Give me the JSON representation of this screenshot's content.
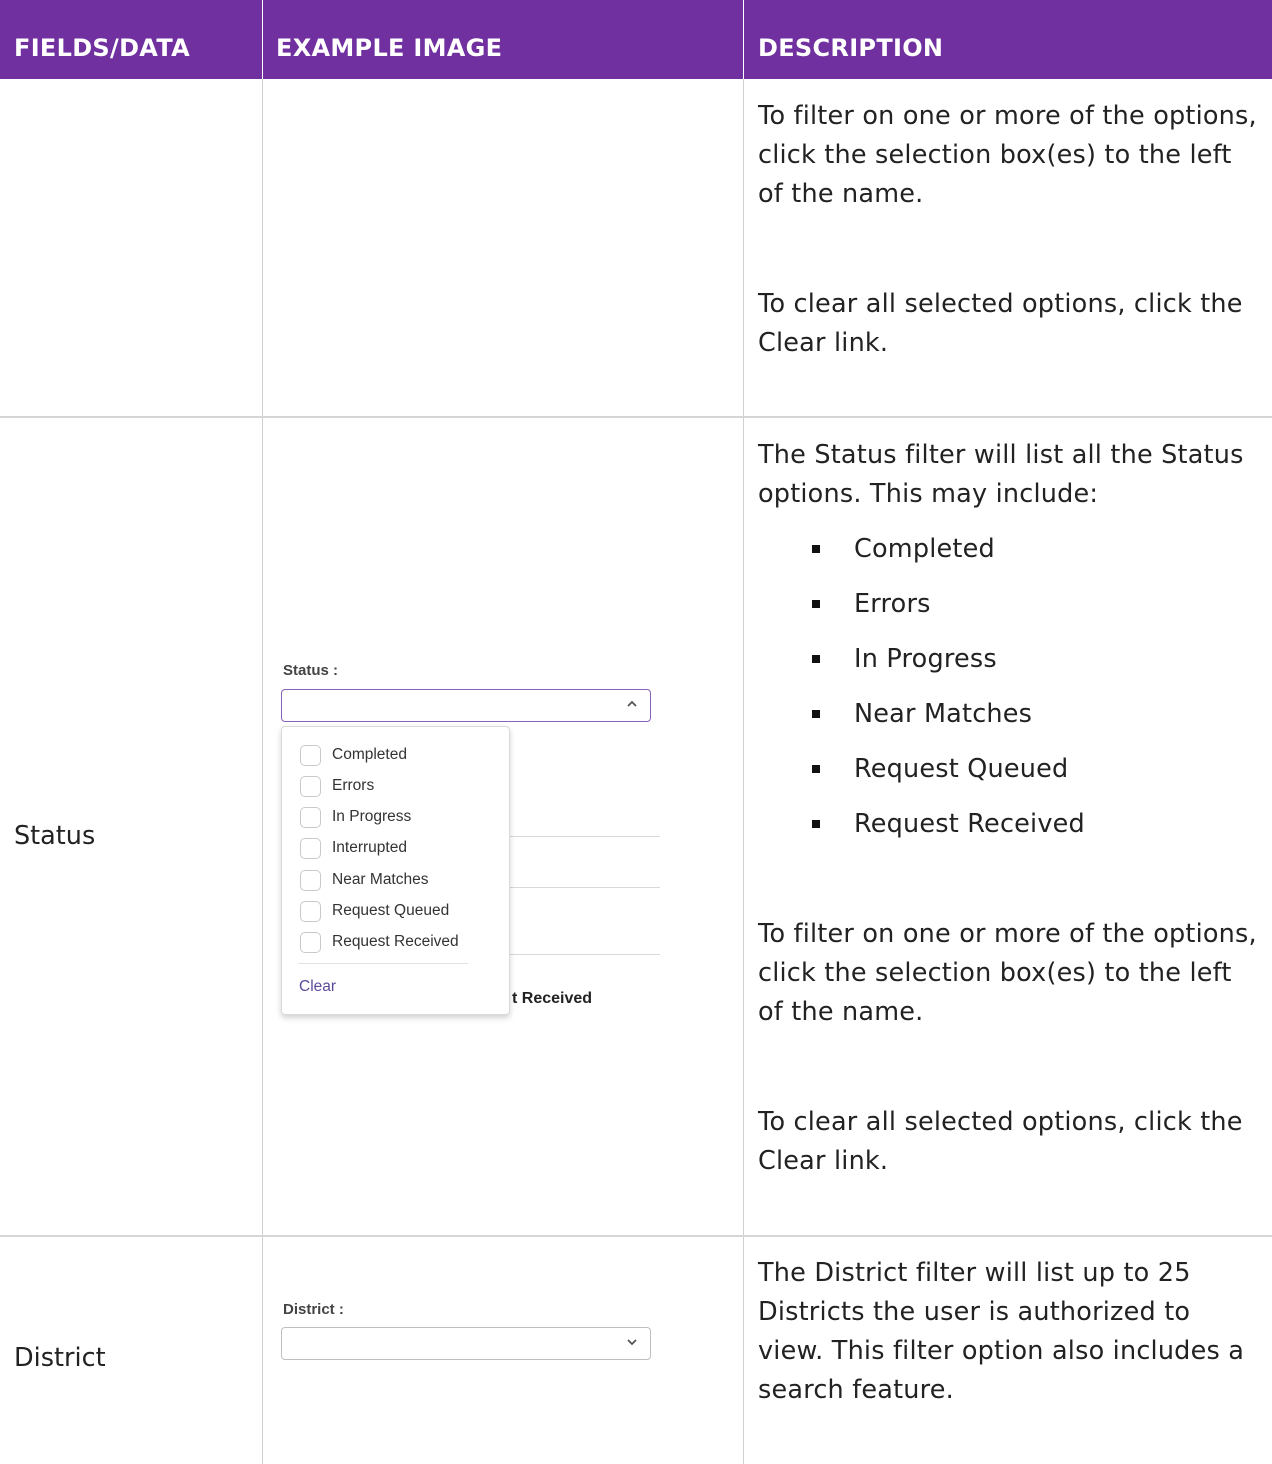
{
  "header": {
    "col1": "FIELDS/DATA",
    "col2": "EXAMPLE IMAGE",
    "col3": "DESCRIPTION"
  },
  "header_color": "#7030a0",
  "rows": {
    "continued": {
      "desc_filter": "To filter on one or more of the options, click the selection box(es) to the left of the name.",
      "desc_clear": "To clear all selected options, click the Clear link."
    },
    "status": {
      "field": "Status",
      "desc_intro": "The Status filter will list all the Status options. This may include:",
      "bullets": [
        "Completed",
        "Errors",
        "In Progress",
        "Near Matches",
        "Request Queued",
        "Request Received"
      ],
      "desc_filter": "To filter on one or more of the options, click the selection box(es) to the left of the name.",
      "desc_clear": "To clear all selected options, click the Clear link.",
      "mock": {
        "label": "Status :",
        "chevron_icon": "chevron-up-icon",
        "options": [
          "Completed",
          "Errors",
          "In Progress",
          "Interrupted",
          "Near Matches",
          "Request Queued",
          "Request Received"
        ],
        "clear_label": "Clear",
        "background_text": "t Received"
      }
    },
    "district": {
      "field": "District",
      "desc": "The District filter will list up to 25 Districts the user is authorized to view. This filter option also includes a search feature.",
      "mock": {
        "label": "District :",
        "chevron_icon": "chevron-down-icon"
      }
    }
  }
}
